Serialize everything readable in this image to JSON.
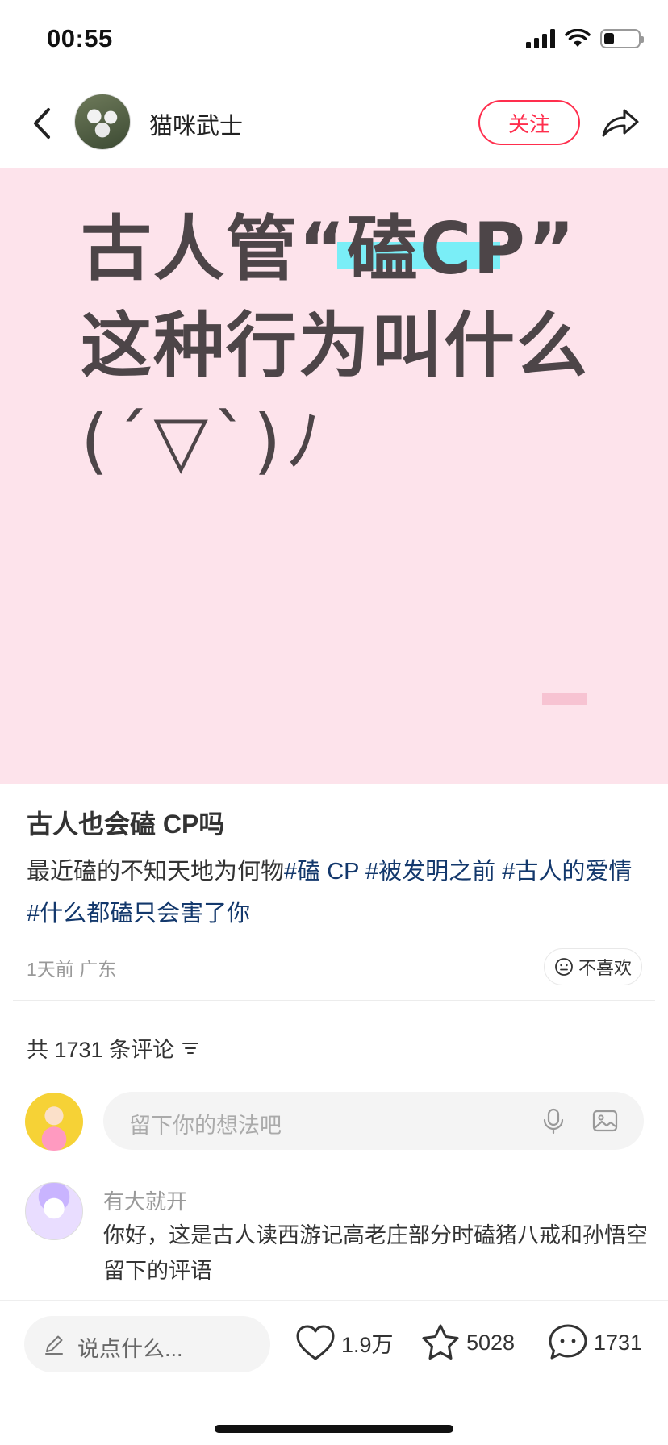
{
  "status_bar": {
    "time": "00:55",
    "battery_level": 0.3
  },
  "header": {
    "author_name": "猫咪武士",
    "follow_label": "关注",
    "icons": {
      "back": "chevron-left-icon",
      "share": "share-arrow-icon"
    }
  },
  "hero": {
    "line1": "古人管“磕CP”",
    "line2": "这种行为叫什么",
    "line3": "(´▽`)ﾉ",
    "background_color": "#fde3eb",
    "highlight_color": "#7aeef7"
  },
  "post": {
    "title": "古人也会磕 CP吗",
    "body_text": "最近磕的不知天地为何物",
    "tags": [
      "#磕 CP",
      "#被发明之前",
      "#古人的爱情",
      "#什么都磕只会害了你"
    ],
    "time": "1天前",
    "location": "广东",
    "dislike_label": "不喜欢"
  },
  "comments": {
    "count_label": "共 1731 条评论",
    "input_placeholder": "留下你的想法吧",
    "items": [
      {
        "user": "有大就开",
        "text": "你好，这是古人读西游记高老庄部分时磕猪八戒和孙悟空留下的评语"
      }
    ]
  },
  "bottom_bar": {
    "input_placeholder": "说点什么...",
    "likes": "1.9万",
    "favorites": "5028",
    "comments": "1731"
  },
  "colors": {
    "accent": "#ff2e4d",
    "tag": "#13386c"
  }
}
